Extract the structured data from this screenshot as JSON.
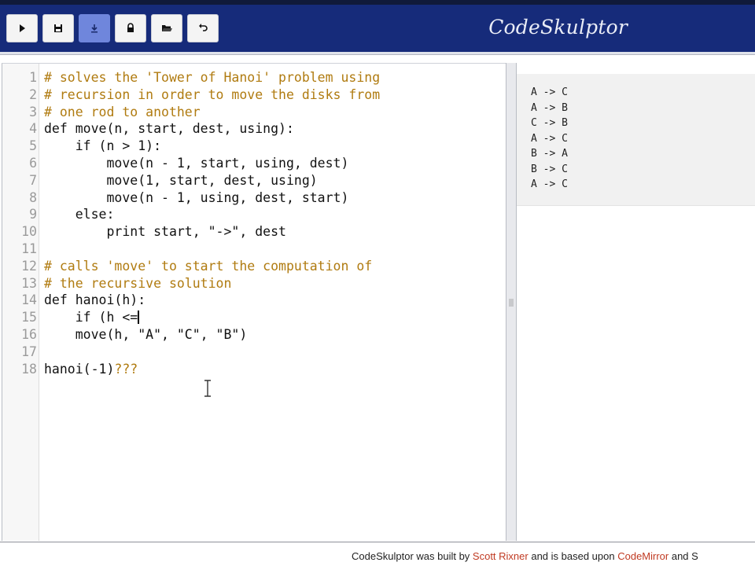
{
  "app": {
    "brand": "CodeSkulptor",
    "colors": {
      "header": "#162b7a",
      "active_button": "#6f86dc",
      "comment": "#b07b10",
      "link": "#c03a22"
    }
  },
  "toolbar": {
    "buttons": [
      {
        "icon": "play-icon",
        "active": false
      },
      {
        "icon": "save-icon",
        "active": false
      },
      {
        "icon": "download-icon",
        "active": true
      },
      {
        "icon": "lock-icon",
        "active": false
      },
      {
        "icon": "open-folder-icon",
        "active": false
      },
      {
        "icon": "undo-icon",
        "active": false
      }
    ]
  },
  "editor": {
    "lines": [
      {
        "n": "1",
        "text": "# solves the 'Tower of Hanoi' problem using",
        "kind": "comment"
      },
      {
        "n": "2",
        "text": "# recursion in order to move the disks from",
        "kind": "comment"
      },
      {
        "n": "3",
        "text": "# one rod to another",
        "kind": "comment"
      },
      {
        "n": "4",
        "text": "def move(n, start, dest, using):",
        "kind": "code"
      },
      {
        "n": "5",
        "text": "    if (n > 1):",
        "kind": "code"
      },
      {
        "n": "6",
        "text": "        move(n - 1, start, using, dest)",
        "kind": "code"
      },
      {
        "n": "7",
        "text": "        move(1, start, dest, using)",
        "kind": "code"
      },
      {
        "n": "8",
        "text": "        move(n - 1, using, dest, start)",
        "kind": "code"
      },
      {
        "n": "9",
        "text": "    else:",
        "kind": "code"
      },
      {
        "n": "10",
        "text": "        print start, \"->\", dest",
        "kind": "code"
      },
      {
        "n": "11",
        "text": "",
        "kind": "code"
      },
      {
        "n": "12",
        "text": "# calls 'move' to start the computation of",
        "kind": "comment"
      },
      {
        "n": "13",
        "text": "# the recursive solution",
        "kind": "comment"
      },
      {
        "n": "14",
        "text": "def hanoi(h):",
        "kind": "code"
      },
      {
        "n": "15",
        "text": "    if (h <=",
        "kind": "code",
        "cursor": true
      },
      {
        "n": "16",
        "text": "    move(h, \"A\", \"C\", \"B\")",
        "kind": "code"
      },
      {
        "n": "17",
        "text": "",
        "kind": "code"
      },
      {
        "n": "18",
        "text": "hanoi(-1)",
        "kind": "code",
        "suffix": "???"
      }
    ]
  },
  "output": {
    "lines": [
      "A -> C",
      "A -> B",
      "C -> B",
      "A -> C",
      "B -> A",
      "B -> C",
      "A -> C"
    ]
  },
  "footer": {
    "t1": "CodeSkulptor was built by ",
    "link1": "Scott Rixner",
    "t2": " and is based upon ",
    "link2": "CodeMirror",
    "t3": " and S"
  }
}
